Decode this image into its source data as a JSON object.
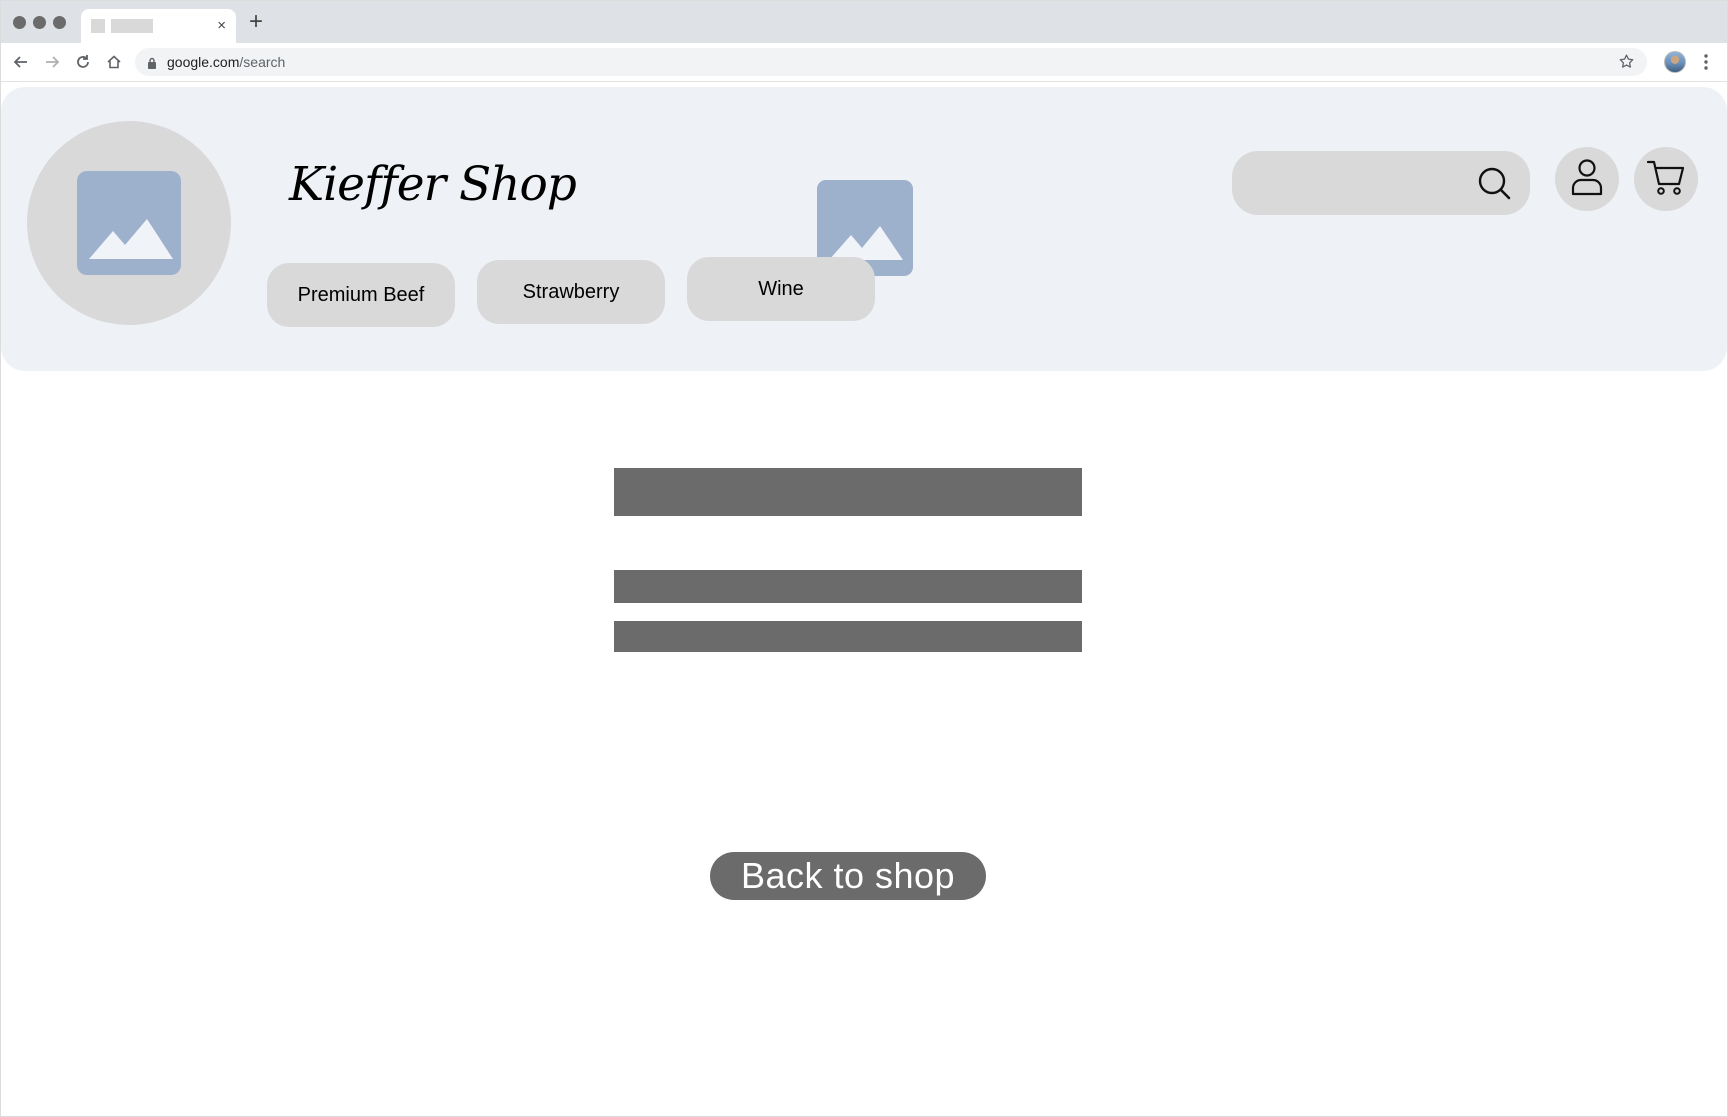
{
  "browser": {
    "tab_close": "×",
    "new_tab": "+",
    "url_host": "google.com",
    "url_path": "/search"
  },
  "shop": {
    "brand": "Kieffer Shop",
    "categories": [
      {
        "label": "Premium Beef"
      },
      {
        "label": "Strawberry"
      },
      {
        "label": "Wine"
      }
    ],
    "search_icon": "search-icon",
    "account_icon": "user-icon",
    "cart_icon": "cart-icon",
    "placeholder_image_color": "#9db0cc"
  },
  "main": {
    "back_button_label": "Back to shop"
  }
}
